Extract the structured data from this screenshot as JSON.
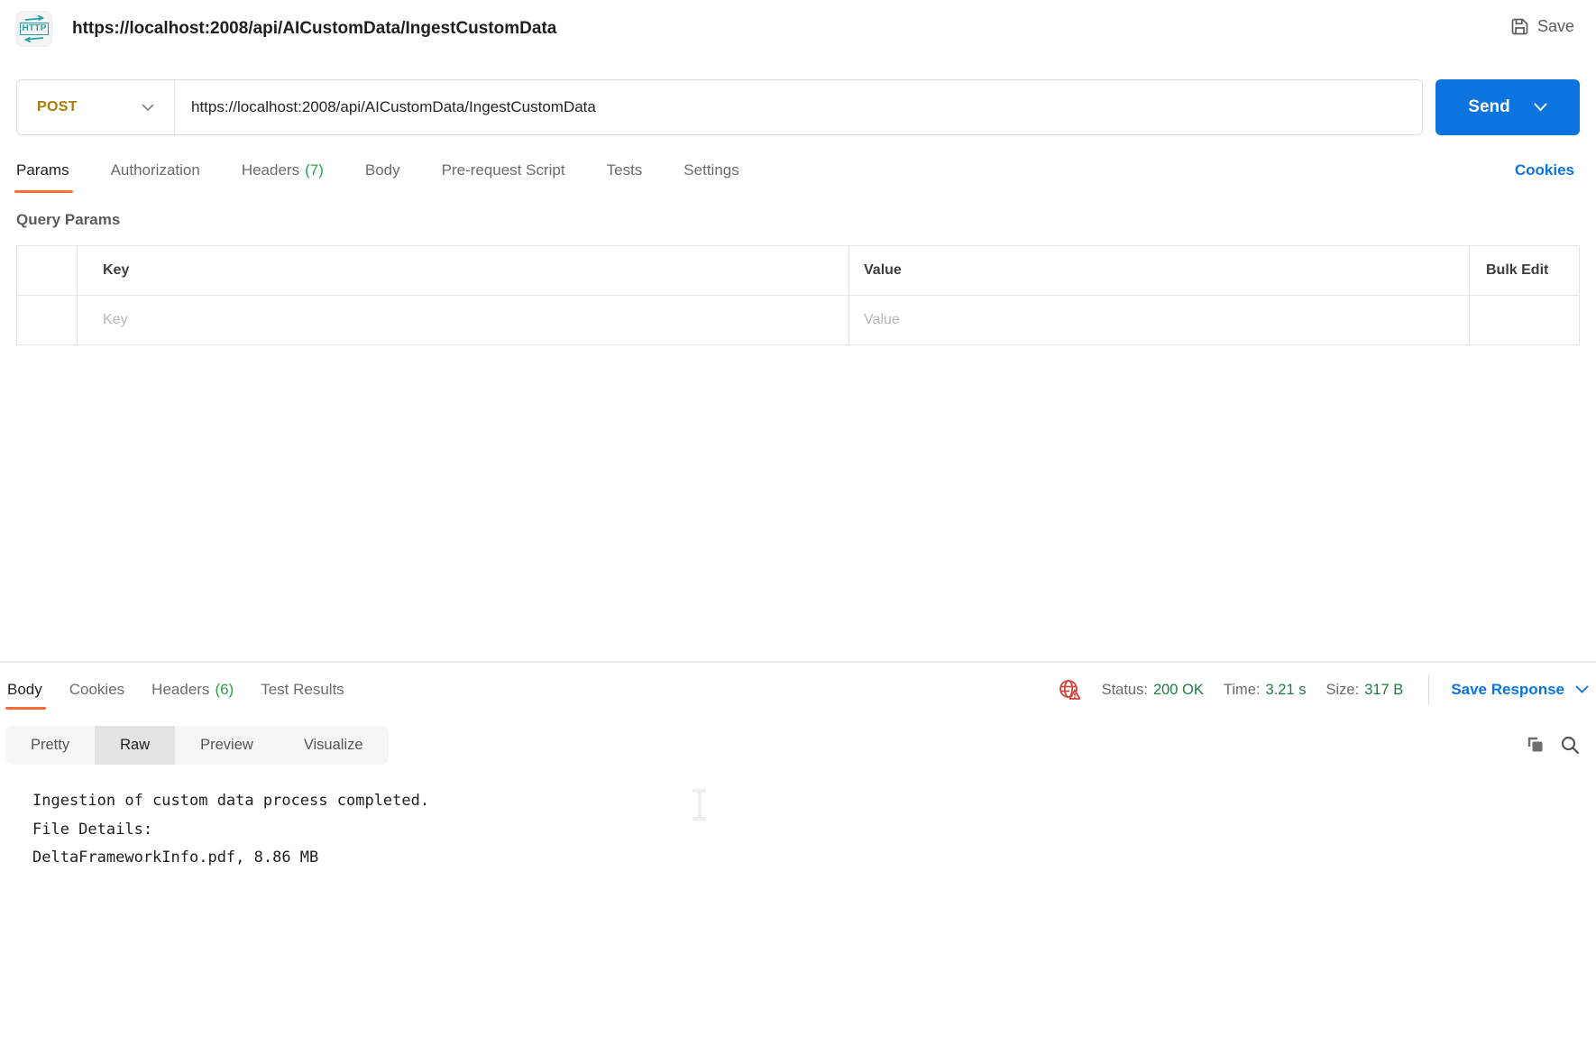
{
  "app": {
    "title": "https://localhost:2008/api/AICustomData/IngestCustomData",
    "save_label": "Save"
  },
  "request": {
    "method": "POST",
    "url": "https://localhost:2008/api/AICustomData/IngestCustomData",
    "send_label": "Send",
    "tabs": [
      {
        "label": "Params",
        "active": true
      },
      {
        "label": "Authorization",
        "active": false
      },
      {
        "label": "Headers",
        "count": "(7)",
        "active": false
      },
      {
        "label": "Body",
        "active": false
      },
      {
        "label": "Pre-request Script",
        "active": false
      },
      {
        "label": "Tests",
        "active": false
      },
      {
        "label": "Settings",
        "active": false
      }
    ],
    "cookies_link": "Cookies"
  },
  "query_params": {
    "title": "Query Params",
    "columns": {
      "key": "Key",
      "value": "Value",
      "bulk_edit": "Bulk Edit"
    },
    "row_placeholders": {
      "key": "Key",
      "value": "Value"
    }
  },
  "response": {
    "tabs": [
      {
        "label": "Body",
        "active": true
      },
      {
        "label": "Cookies",
        "active": false
      },
      {
        "label": "Headers",
        "count": "(6)",
        "active": false
      },
      {
        "label": "Test Results",
        "active": false
      }
    ],
    "status": {
      "label": "Status:",
      "value": "200 OK"
    },
    "time": {
      "label": "Time:",
      "value": "3.21 s"
    },
    "size": {
      "label": "Size:",
      "value": "317 B"
    },
    "save_response_label": "Save Response",
    "view_tabs": [
      {
        "label": "Pretty",
        "active": false
      },
      {
        "label": "Raw",
        "active": true
      },
      {
        "label": "Preview",
        "active": false
      },
      {
        "label": "Visualize",
        "active": false
      }
    ],
    "body_lines": [
      "Ingestion of custom data process completed.",
      "File Details:",
      "DeltaFrameworkInfo.pdf, 8.86 MB"
    ]
  },
  "icons": {
    "http_badge_text": "HTTP",
    "save": "floppy-disk",
    "method_dropdown": "chevron-down",
    "send_options": "chevron-down",
    "network_warning": "globe-with-warning-triangle",
    "copy": "overlapping-squares",
    "search": "magnifier",
    "save_response_options": "chevron-down",
    "text_cursor": "i-beam"
  },
  "colors": {
    "accent_orange": "#ff6c37",
    "method_post": "#ad7a03",
    "primary_blue": "#0b74de",
    "count_green": "#29a248",
    "value_green": "#1d7b43",
    "error_red": "#d5443c",
    "http_teal": "#2a9fa4"
  }
}
